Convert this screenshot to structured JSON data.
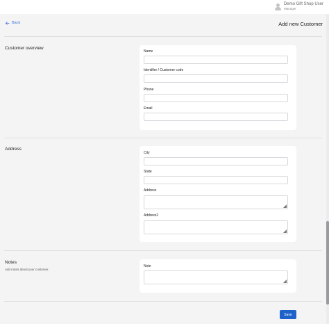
{
  "header": {
    "user_name": "Demo Gift Shop User",
    "user_role": "Manager"
  },
  "nav": {
    "back_label": "Back",
    "page_title": "Add new Customer"
  },
  "sections": {
    "overview": {
      "title": "Customer overview",
      "fields": {
        "name": {
          "label": "Name",
          "value": ""
        },
        "identifier": {
          "label": "Identifier / Customer code",
          "value": ""
        },
        "phone": {
          "label": "Phone",
          "value": ""
        },
        "email": {
          "label": "Email",
          "value": ""
        }
      }
    },
    "address": {
      "title": "Address",
      "fields": {
        "city": {
          "label": "City",
          "value": ""
        },
        "state": {
          "label": "State",
          "value": ""
        },
        "address": {
          "label": "Address",
          "value": ""
        },
        "address2": {
          "label": "Address2",
          "value": ""
        }
      }
    },
    "notes": {
      "title": "Notes",
      "description": "Add notes about your customer.",
      "fields": {
        "note": {
          "label": "Note",
          "value": ""
        }
      }
    }
  },
  "actions": {
    "save_label": "Save"
  },
  "colors": {
    "accent": "#1f62c9",
    "link": "#3b6fd6",
    "background": "#f4f4f5",
    "card": "#ffffff"
  }
}
